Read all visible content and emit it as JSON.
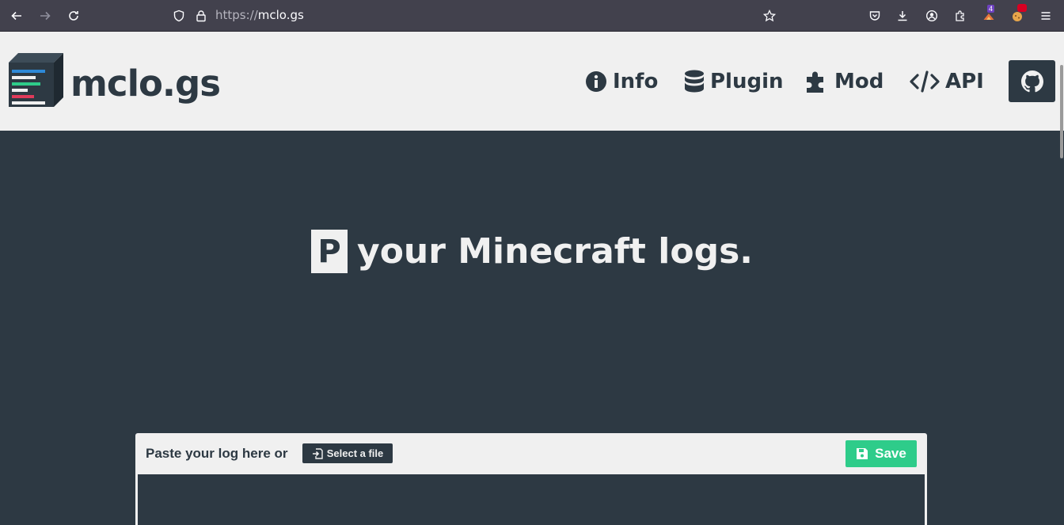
{
  "browser": {
    "url_scheme": "https://",
    "url_host": "mclo.gs",
    "extension_badge_1": "4"
  },
  "header": {
    "logo_text": "mclo.gs",
    "nav": [
      {
        "label": "Info",
        "icon": "info-circle-icon"
      },
      {
        "label": "Plugin",
        "icon": "database-icon"
      },
      {
        "label": "Mod",
        "icon": "puzzle-piece-icon"
      },
      {
        "label": "API",
        "icon": "code-icon"
      }
    ],
    "github_icon": "github-icon"
  },
  "hero": {
    "highlight_letter": "P",
    "text": "your Minecraft logs."
  },
  "paste": {
    "label": "Paste your log here or",
    "select_file": "Select a file",
    "save": "Save"
  },
  "colors": {
    "dark": "#2d3943",
    "light": "#f0f0f0",
    "save_green": "#2ecc8a"
  }
}
